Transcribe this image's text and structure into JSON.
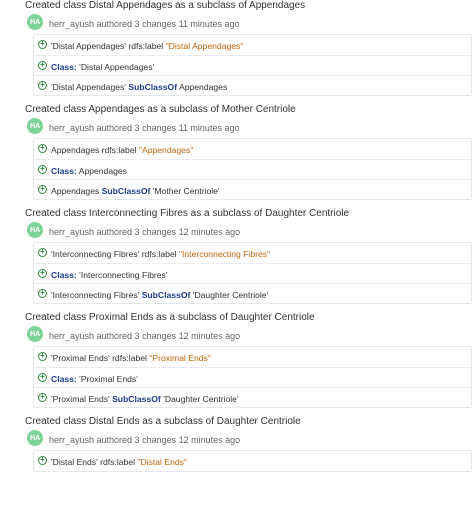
{
  "entries": [
    {
      "title": "Created class Distal Appendages as a subclass of Appendages",
      "avatar": "HA",
      "meta": "herr_ayush authored 3 changes 11 minutes ago",
      "changes": [
        {
          "pre": "'Distal Appendages' rdfs:label ",
          "kw": "",
          "lit": "\"Distal Appendages\"",
          "post": ""
        },
        {
          "pre": "",
          "kw": "Class:",
          "lit": "",
          "post": " 'Distal Appendages'"
        },
        {
          "pre": "'Distal Appendages' ",
          "kw": "SubClassOf",
          "lit": "",
          "post": " Appendages"
        }
      ]
    },
    {
      "title": "Created class Appendages as a subclass of Mother Centriole",
      "avatar": "HA",
      "meta": "herr_ayush authored 3 changes 11 minutes ago",
      "changes": [
        {
          "pre": "Appendages rdfs:label ",
          "kw": "",
          "lit": "\"Appendages\"",
          "post": ""
        },
        {
          "pre": "",
          "kw": "Class:",
          "lit": "",
          "post": " Appendages"
        },
        {
          "pre": "Appendages ",
          "kw": "SubClassOf",
          "lit": "",
          "post": " 'Mother Centriole'"
        }
      ]
    },
    {
      "title": "Created class Interconnecting Fibres as a subclass of Daughter Centriole",
      "avatar": "HA",
      "meta": "herr_ayush authored 3 changes 12 minutes ago",
      "changes": [
        {
          "pre": "'Interconnecting Fibres' rdfs:label ",
          "kw": "",
          "lit": "\"Interconnecting Fibres\"",
          "post": ""
        },
        {
          "pre": "",
          "kw": "Class:",
          "lit": "",
          "post": " 'Interconnecting Fibres'"
        },
        {
          "pre": "'Interconnecting Fibres' ",
          "kw": "SubClassOf",
          "lit": "",
          "post": " 'Daughter Centriole'"
        }
      ]
    },
    {
      "title": "Created class Proximal Ends as a subclass of Daughter Centriole",
      "avatar": "HA",
      "meta": "herr_ayush authored 3 changes 12 minutes ago",
      "changes": [
        {
          "pre": "'Proximal Ends' rdfs:label ",
          "kw": "",
          "lit": "\"Proximal Ends\"",
          "post": ""
        },
        {
          "pre": "",
          "kw": "Class:",
          "lit": "",
          "post": " 'Proximal Ends'"
        },
        {
          "pre": "'Proximal Ends' ",
          "kw": "SubClassOf",
          "lit": "",
          "post": " 'Daughter Centriole'"
        }
      ]
    },
    {
      "title": "Created class Distal Ends as a subclass of Daughter Centriole",
      "avatar": "HA",
      "meta": "herr_ayush authored 3 changes 12 minutes ago",
      "changes": [
        {
          "pre": "'Distal Ends' rdfs:label ",
          "kw": "",
          "lit": "\"Distal Ends\"",
          "post": ""
        }
      ]
    }
  ],
  "colors": {
    "avatar_bg": "#7fd39a",
    "add_icon": "#2e8b3e",
    "keyword": "#1a3f8f",
    "literal": "#c0650c"
  },
  "icons": {
    "change_icon": "add-circle-icon"
  }
}
